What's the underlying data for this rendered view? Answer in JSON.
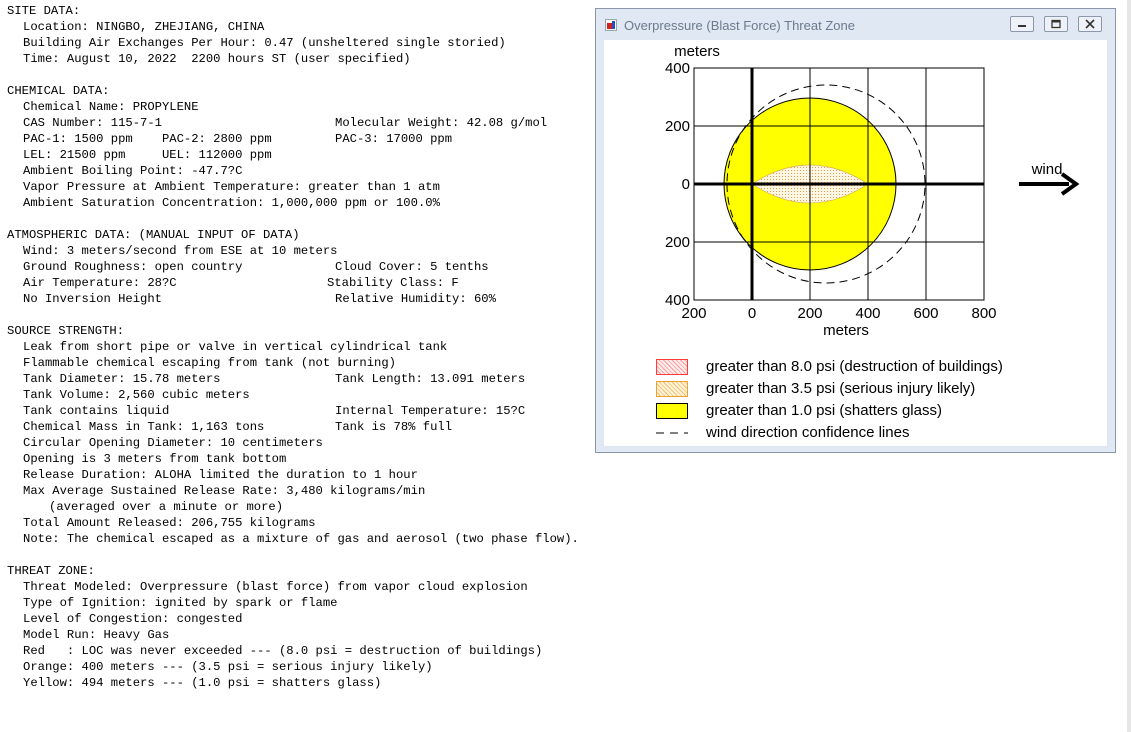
{
  "report": {
    "site": {
      "heading": "SITE DATA:",
      "location": "Location: NINGBO, ZHEJIANG, CHINA",
      "air_exchanges": "Building Air Exchanges Per Hour: 0.47 (unsheltered single storied)",
      "time": "Time: August 10, 2022  2200 hours ST (user specified)"
    },
    "chemical": {
      "heading": "CHEMICAL DATA:",
      "name": "Chemical Name: PROPYLENE",
      "cas": "CAS Number: 115-7-1",
      "mw": "Molecular Weight: 42.08 g/mol",
      "pac12": "PAC-1: 1500 ppm    PAC-2: 2800 ppm",
      "pac3": "PAC-3: 17000 ppm",
      "lel_uel": "LEL: 21500 ppm     UEL: 112000 ppm",
      "boiling": "Ambient Boiling Point: -47.7?C",
      "vapor": "Vapor Pressure at Ambient Temperature: greater than 1 atm",
      "saturation": "Ambient Saturation Concentration: 1,000,000 ppm or 100.0%"
    },
    "atmos": {
      "heading": "ATMOSPHERIC DATA: (MANUAL INPUT OF DATA)",
      "wind": "Wind: 3 meters/second from ESE at 10 meters",
      "roughness": "Ground Roughness: open country",
      "cloud": "Cloud Cover: 5 tenths",
      "air_temp": "Air Temperature: 28?C",
      "stability": "Stability Class: F",
      "inversion": "No Inversion Height",
      "humidity": "Relative Humidity: 60%"
    },
    "source": {
      "heading": "SOURCE STRENGTH:",
      "leak": "Leak from short pipe or valve in vertical cylindrical tank",
      "flammable": "Flammable chemical escaping from tank (not burning)",
      "diameter": "Tank Diameter: 15.78 meters",
      "length": "Tank Length: 13.091 meters",
      "volume": "Tank Volume: 2,560 cubic meters",
      "contains": "Tank contains liquid",
      "int_temp": "Internal Temperature: 15?C",
      "mass": "Chemical Mass in Tank: 1,163 tons",
      "full": "Tank is 78% full",
      "opening_dia": "Circular Opening Diameter: 10 centimeters",
      "opening_pos": "Opening is 3 meters from tank bottom",
      "duration": "Release Duration: ALOHA limited the duration to 1 hour",
      "rate": "Max Average Sustained Release Rate: 3,480 kilograms/min",
      "averaged": "(averaged over a minute or more)",
      "total": "Total Amount Released: 206,755 kilograms",
      "note": "Note: The chemical escaped as a mixture of gas and aerosol (two phase flow)."
    },
    "threat": {
      "heading": "THREAT ZONE:",
      "modeled": "Threat Modeled: Overpressure (blast force) from vapor cloud explosion",
      "ignition": "Type of Ignition: ignited by spark or flame",
      "congestion": "Level of Congestion: congested",
      "model_run": "Model Run: Heavy Gas",
      "red": "Red   : LOC was never exceeded --- (8.0 psi = destruction of buildings)",
      "orange": "Orange: 400 meters --- (3.5 psi = serious injury likely)",
      "yellow": "Yellow: 494 meters --- (1.0 psi = shatters glass)"
    }
  },
  "window": {
    "title": "Overpressure (Blast Force) Threat Zone",
    "buttons": [
      "minimize",
      "restore",
      "close"
    ]
  },
  "plot": {
    "y_unit_label": "meters",
    "x_unit_label": "meters",
    "x_ticks": [
      "200",
      "0",
      "200",
      "400",
      "600",
      "800"
    ],
    "y_ticks": [
      "400",
      "200",
      "0",
      "200",
      "400"
    ],
    "wind_label": "wind",
    "zones": {
      "yellow_radius_m": 494,
      "orange_radius_m": 400,
      "orange_upwind_extent_m": 200,
      "orange_downwind_extent_m": 400
    }
  },
  "legend": [
    {
      "label": "greater than 8.0 psi (destruction of buildings)",
      "color": "#ff3333"
    },
    {
      "label": "greater than 3.5 psi (serious injury likely)",
      "color": "#f0a030"
    },
    {
      "label": "greater than 1.0 psi (shatters glass)",
      "color": "#ffff00"
    },
    {
      "label": "wind direction confidence lines",
      "color": "#000000"
    }
  ]
}
